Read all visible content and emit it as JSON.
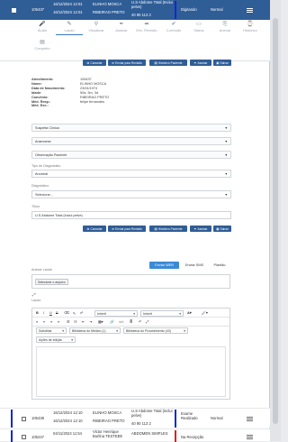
{
  "top_row": {
    "id": "105437",
    "date1": "16/12/2024 12:01",
    "date2": "16/12/2024 12:01",
    "patient": "ELINHO MOSCA",
    "city": "RIBEIRAO PRETO",
    "exam": "U.S Abdome Total (Inclui pelve)",
    "exam_code": "40 90 113 2",
    "status": "Digitando",
    "priority": "Normal"
  },
  "toolbar": {
    "items": [
      {
        "label": "Áudio",
        "icon": "audio-icon"
      },
      {
        "label": "Laudo",
        "icon": "report-icon"
      },
      {
        "label": "Visualizar",
        "icon": "search-icon"
      },
      {
        "label": "Assinar",
        "icon": "pen-icon"
      },
      {
        "label": "Env. Revisão",
        "icon": "send-icon"
      },
      {
        "label": "Correção",
        "icon": "check-icon"
      },
      {
        "label": "Status",
        "icon": "status-icon"
      },
      {
        "label": "Anexar",
        "icon": "attach-icon"
      },
      {
        "label": "Histórico",
        "icon": "history-icon"
      }
    ],
    "extra": "Completo"
  },
  "actions": {
    "cancel": "Cancelar",
    "send_review": "Enviar para Revisão",
    "history": "Histórico Paciente",
    "sign": "Assinar",
    "save": "Salvar"
  },
  "patient_info": {
    "atendimento_label": "Atendimento:",
    "atendimento": "105437",
    "nome_label": "Nome:",
    "nome": "ELINHO MOSCA",
    "nasc_label": "Data de Nascimento:",
    "nasc": "23/04/1974",
    "idade_label": "Idade:",
    "idade": "50a, 5m, 3d",
    "convenio_label": "Convênio:",
    "convenio": "RIBEIRAO PRETO",
    "resp_label": "Méd. Resp.:",
    "resp": "felipe fernandes",
    "exe_label": "Méd. Exe.:",
    "exe": ""
  },
  "panels": {
    "suspeita": "Suspeita Clínica",
    "anamnese": "Anamnese",
    "observacao": "Observação Paciente"
  },
  "form": {
    "tipo_label": "Tipo de Diagnóstico",
    "tipo_value": "Anormal",
    "diag_label": "Diagnóstico",
    "diag_value": "Selecione...",
    "titulo_label": "Título",
    "titulo_value": "U.S Abdome Total (inclui pelve)"
  },
  "send_tabs": {
    "web": "Enviar WEB",
    "sms": "Enviar SMS",
    "plantao": "Plantão"
  },
  "attach": {
    "label": "Anexar Laudo",
    "button": "Selecione o arquivo"
  },
  "editor": {
    "label": "Laudo",
    "font": "Inherit",
    "size": "Inherit",
    "substituir": "Substituir",
    "bib_medico": "Biblioteca do Médico (1)",
    "bib_proc": "Biblioteca do Procedimento (43)",
    "acoes": "Ações de edição"
  },
  "rows": [
    {
      "id": "105438",
      "date1": "16/12/2024 12:10",
      "date2": "16/12/2024 12:10",
      "patient": "ELINHO MOSCA",
      "city": "RIBEIRAO PRETO",
      "exam": "U.S Abdome Total (inclui pelve)",
      "exam_code": "40 90 113 2",
      "status": "Exame Realizado",
      "priority": "Normal"
    },
    {
      "id": "105247",
      "date1": "04/11/2024 11:54",
      "date2": "",
      "patient": "Victor Henrique Burlina TESTEEE",
      "city": "",
      "exam": "ABDOMEN SIMPLES",
      "exam_code": "",
      "status": "Na Recepção",
      "priority": ""
    }
  ],
  "colors": {
    "primary": "#2f5d96",
    "status_blue": "#1326d8",
    "status_red": "#e02020"
  }
}
